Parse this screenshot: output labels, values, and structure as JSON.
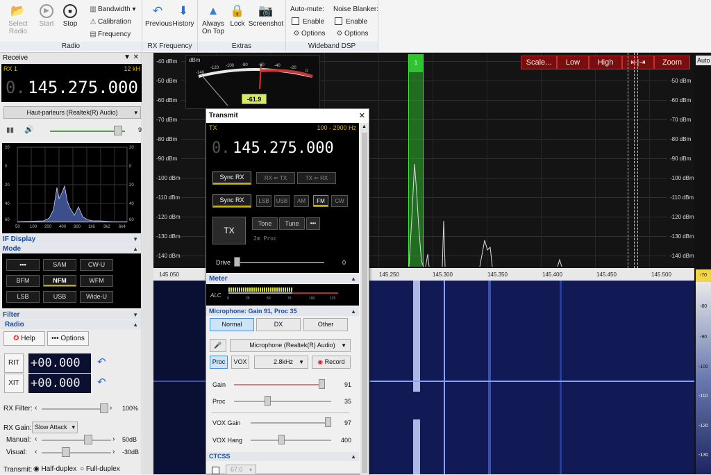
{
  "ribbon": {
    "radio": {
      "select_radio": "Select\nRadio",
      "start": "Start",
      "stop": "Stop",
      "bandwidth": "Bandwidth",
      "calibration": "Calibration",
      "frequency": "Frequency",
      "label": "Radio"
    },
    "rxfreq": {
      "previous": "Previous",
      "history": "History",
      "label": "RX Frequency"
    },
    "extras": {
      "always_on_top": "Always\nOn Top",
      "lock": "Lock",
      "screenshot": "Screenshot",
      "label": "Extras"
    },
    "dsp": {
      "automute": "Auto-mute:",
      "enable": "Enable",
      "options": "Options",
      "noise_blanker": "Noise Blanker:",
      "label": "Wideband DSP"
    }
  },
  "receive": {
    "title": "Receive",
    "rx": "RX 1",
    "bw": "12 kH",
    "freq_dim": "0.",
    "freq": "145.275.000",
    "audio_device": "Haut-parleurs (Realtek(R) Audio)",
    "vol_value": "9",
    "if_scale": [
      "20",
      "0",
      "20",
      "40",
      "60"
    ],
    "if_xlabels": [
      "50",
      "100",
      "200",
      "400",
      "800",
      "1k6",
      "3k2",
      "6k4"
    ]
  },
  "if_display": "IF Display",
  "mode": {
    "title": "Mode",
    "buttons": [
      "•••",
      "SAM",
      "CW-U",
      "BFM",
      "NFM",
      "WFM",
      "LSB",
      "USB",
      "Wide-U"
    ],
    "active": "NFM"
  },
  "filter": "Filter",
  "radio": {
    "title": "Radio",
    "help": "Help",
    "options": "••• Options",
    "rit": "RIT",
    "rit_val": "+00.000",
    "xit": "XIT",
    "xit_val": "+00.000",
    "rx_filter": "RX Filter:",
    "rx_filter_val": "100%",
    "rx_gain": "RX Gain:",
    "rx_gain_sel": "Slow Attack",
    "manual": "Manual:",
    "manual_val": "50dB",
    "visual": "Visual:",
    "visual_val": "-30dB",
    "transmit": "Transmit:",
    "half_duplex": "Half-duplex",
    "full_duplex": "Full-duplex"
  },
  "spectrum": {
    "dbm_unit": "dBm",
    "dbm_labels": [
      "-40 dBm",
      "-50 dBm",
      "-60 dBm",
      "-70 dBm",
      "-80 dBm",
      "-90 dBm",
      "-100 dBm",
      "-110 dBm",
      "-120 dBm",
      "-130 dBm",
      "-140 dBm"
    ],
    "buttons": [
      "Scale...",
      "Low",
      "High",
      "⇤|⇥",
      "Zoom"
    ],
    "marker": "1",
    "freqs": [
      "145.050",
      "145.250",
      "145.300",
      "145.350",
      "145.400",
      "145.450",
      "145.500"
    ],
    "smeter_scale": [
      "-140",
      "-120",
      "-100",
      "-80",
      "-60",
      "-40",
      "-20",
      "0"
    ],
    "smeter_value": "-61.9"
  },
  "right_panel": {
    "label": "Auto",
    "levels": [
      "-70",
      "-80",
      "-90",
      "-100",
      "-110",
      "-120",
      "-130"
    ]
  },
  "transmit": {
    "title": "Transmit",
    "tx": "TX",
    "bw": "100 - 2900 Hz",
    "freq_dim": "0.",
    "freq": "145.275.000",
    "sync_rx": "Sync RX",
    "rx_tx": "RX ⇐ TX",
    "tx_rx": "TX ⇐ RX",
    "sync_rx2": "Sync RX",
    "modes": [
      "LSB",
      "USB",
      "AM",
      "FM",
      "CW"
    ],
    "tx_btn": "TX",
    "tone": "Tone",
    "tune": "Tune",
    "more": "•••",
    "proc_info": "2m Proc",
    "drive": "Drive",
    "drive_val": "0",
    "meter": "Meter",
    "alc": "ALC",
    "alc_scale": [
      "0",
      "25",
      "50",
      "75",
      "100",
      "125"
    ],
    "mic": "Microphone: Gain 91, Proc 35",
    "normal": "Normal",
    "dx": "DX",
    "other": "Other",
    "mic_device": "Microphone (Realtek(R) Audio)",
    "proc": "Proc",
    "vox": "VOX",
    "bw_sel": "2.8kHz",
    "record": "Record",
    "gain": "Gain",
    "gain_val": "91",
    "proc_l": "Proc",
    "proc_val": "35",
    "vox_gain": "VOX Gain",
    "vox_gain_val": "97",
    "vox_hang": "VOX Hang",
    "vox_hang_val": "400",
    "ctcss": "CTCSS",
    "ctcss_val": "67.0"
  },
  "colors": {
    "accent": "#1a4fa0",
    "marker": "#2fc42f",
    "spectrum_bg": "#141414",
    "waterfall_bg": "#0a0f34",
    "button_red": "#7a0e0e"
  }
}
